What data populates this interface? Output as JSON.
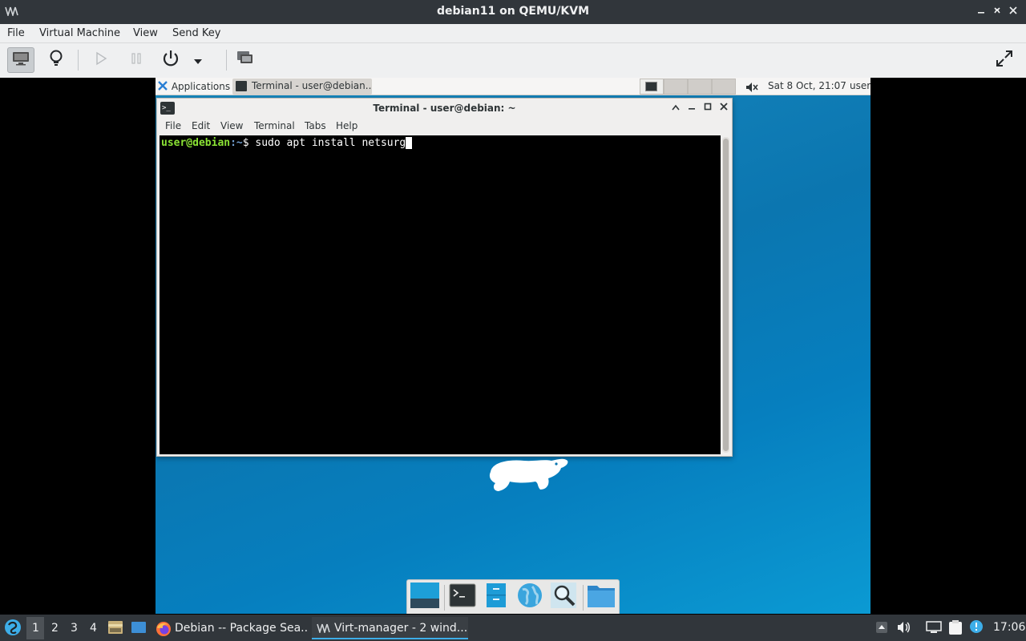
{
  "host_window": {
    "title": "debian11 on QEMU/KVM",
    "menu": [
      "File",
      "Virtual Machine",
      "View",
      "Send Key"
    ]
  },
  "guest_panel": {
    "applications_label": "Applications",
    "task_label": "Terminal - user@debian...",
    "datetime": "Sat  8 Oct, 21:07",
    "user": "user"
  },
  "terminal": {
    "title": "Terminal - user@debian: ~",
    "menu": [
      "File",
      "Edit",
      "View",
      "Terminal",
      "Tabs",
      "Help"
    ],
    "prompt_user": "user@debian",
    "prompt_path": ":~",
    "prompt_symbol": "$ ",
    "command": "sudo apt install netsurg"
  },
  "host_taskbar": {
    "workspaces": [
      "1",
      "2",
      "3",
      "4"
    ],
    "tasks": [
      "Debian -- Package Sea...",
      "Virt-manager - 2 wind..."
    ],
    "clock": "17:06"
  },
  "colors": {
    "host_dark": "#31363b",
    "host_light": "#eff0f1",
    "desktop_blue": "#0b76b0",
    "prompt_green": "#8ae234",
    "prompt_blue": "#729fcf"
  }
}
